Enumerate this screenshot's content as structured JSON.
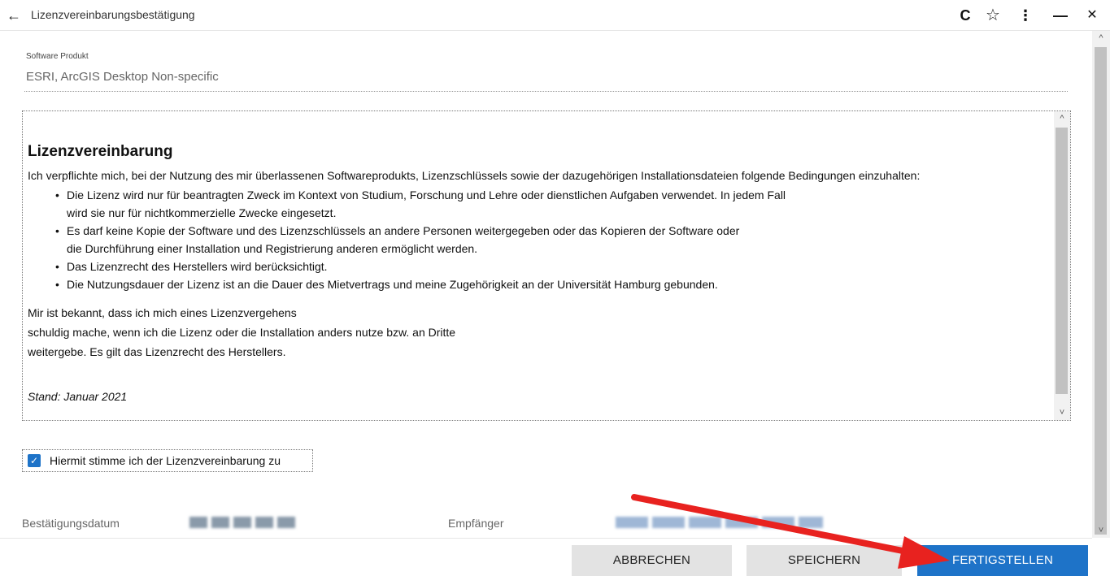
{
  "window": {
    "title": "Lizenzvereinbarungsbestätigung",
    "back_icon": "←",
    "reload_icon": "C",
    "star_icon": "☆",
    "menu_icon": "⋮",
    "minimize_icon": "—",
    "close_icon": "✕"
  },
  "product": {
    "label": "Software Produkt",
    "value": "ESRI, ArcGIS Desktop Non-specific"
  },
  "license": {
    "heading": "Lizenzvereinbarung",
    "intro": "Ich verpflichte mich, bei der Nutzung des mir überlassenen Softwareprodukts, Lizenzschlüssels sowie der dazugehörigen Installationsdateien folgende Bedingungen einzuhalten:",
    "bullets": [
      {
        "line1": "Die Lizenz wird nur für beantragten Zweck im Kontext von Studium, Forschung und Lehre oder dienstlichen Aufgaben verwendet. In jedem Fall",
        "line2": "wird sie nur für nichtkommerzielle Zwecke eingesetzt."
      },
      {
        "line1": "Es darf keine Kopie der Software und des Lizenzschlüssels an andere Personen weitergegeben oder das Kopieren der Software oder",
        "line2": "die Durchführung einer Installation und Registrierung anderen ermöglicht werden."
      },
      {
        "line1": "Das Lizenzrecht des Herstellers wird berücksichtigt.",
        "line2": ""
      },
      {
        "line1": "Die Nutzungsdauer der Lizenz ist an die Dauer des Mietvertrags und meine Zugehörigkeit an der Universität Hamburg gebunden.",
        "line2": ""
      }
    ],
    "para_lines": [
      "Mir ist bekannt, dass ich mich eines Lizenzvergehens",
      "schuldig mache, wenn ich die Lizenz oder die Installation anders nutze bzw. an Dritte",
      "weitergebe. Es gilt das Lizenzrecht des Herstellers."
    ],
    "stand": "Stand: Januar 2021"
  },
  "agree": {
    "checked": true,
    "check_glyph": "✓",
    "label": "Hiermit stimme ich der Lizenzvereinbarung zu"
  },
  "info": {
    "date_label": "Bestätigungsdatum",
    "recipient_label": "Empfänger"
  },
  "buttons": {
    "cancel": "ABBRECHEN",
    "save": "SPEICHERN",
    "finish": "FERTIGSTELLEN"
  },
  "scroll": {
    "up_icon": "^",
    "down_icon": "˅"
  },
  "colors": {
    "accent": "#1e73c8",
    "annotation_arrow": "#e8221f"
  }
}
